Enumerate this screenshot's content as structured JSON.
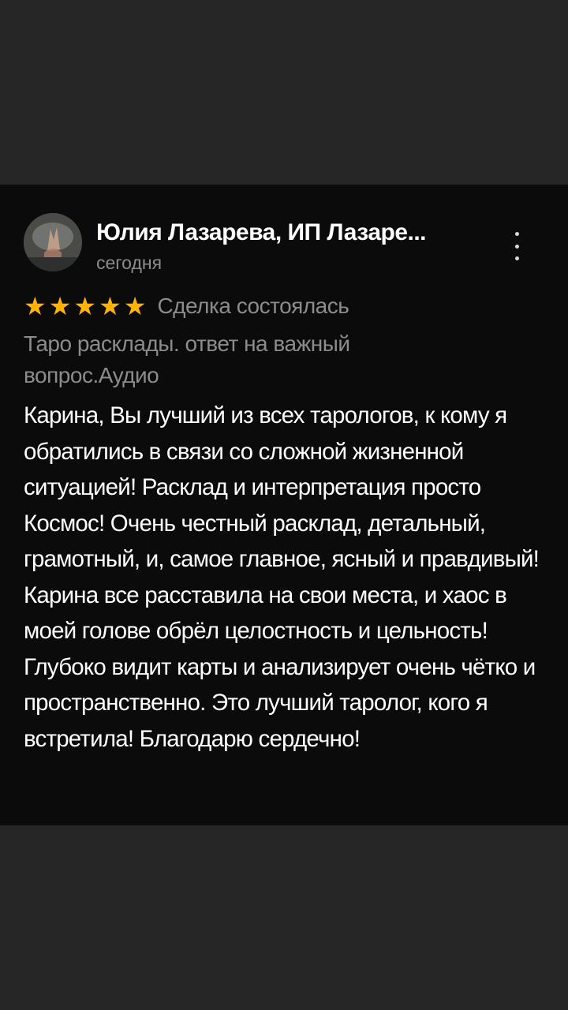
{
  "review": {
    "author": "Юлия Лазарева, ИП Лазаре...",
    "date": "сегодня",
    "rating": 5,
    "rating_max": 5,
    "star_color": "#ffb400",
    "status": "Сделка состоялась",
    "product": "Таро расклады. ответ на важный вопрос.Аудио",
    "text": "Карина, Вы лучший из всех тарологов, к кому я обратились в связи со сложной жизненной ситуацией! Расклад и интерпретация просто Космос! Очень честный расклад, детальный, грамотный, и, самое главное, ясный и правдивый! Карина все расставила на свои места, и хаос в моей голове обрёл целостность и цельность! Глубоко видит карты и анализирует очень чётко и пространственно. Это лучший таролог, кого я встретила! Благодарю сердечно!"
  },
  "icons": {
    "menu": "more-vertical-icon",
    "star": "star-icon"
  },
  "colors": {
    "background": "#262626",
    "card": "#0b0b0b",
    "secondary_text": "#8c8c8c",
    "primary_text": "#ffffff"
  }
}
